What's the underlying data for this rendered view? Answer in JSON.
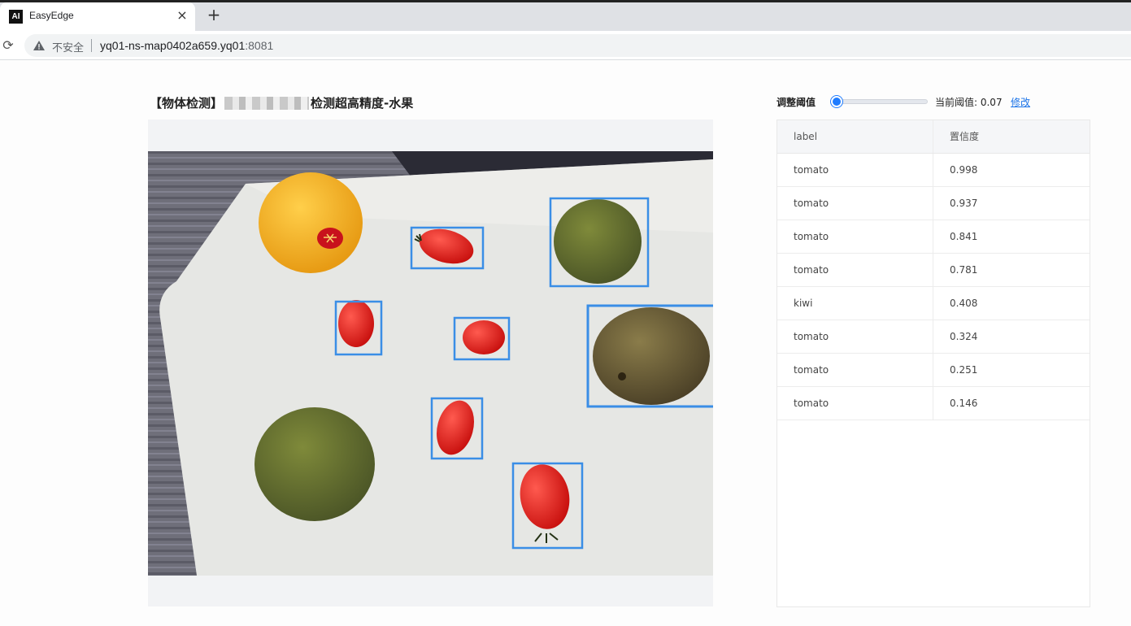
{
  "browser": {
    "tab_title": "EasyEdge",
    "favicon_text": "AI",
    "close_glyph": "×",
    "new_tab_glyph": "+",
    "reload_glyph": "⟳",
    "security_label": "不安全",
    "url_host": "yq01-ns-map0402a659.yq01",
    "url_port": ":8081"
  },
  "page": {
    "title_prefix": "【物体检测】",
    "title_suffix": "检测超高精度-水果"
  },
  "threshold": {
    "label": "调整阈值",
    "value": 0.07,
    "current_text": "当前阈值: 0.07",
    "modify_label": "修改"
  },
  "table": {
    "headers": [
      "label",
      "置信度"
    ],
    "rows": [
      {
        "label": "tomato",
        "score": "0.998"
      },
      {
        "label": "tomato",
        "score": "0.937"
      },
      {
        "label": "tomato",
        "score": "0.841"
      },
      {
        "label": "tomato",
        "score": "0.781"
      },
      {
        "label": "kiwi",
        "score": "0.408"
      },
      {
        "label": "tomato",
        "score": "0.324"
      },
      {
        "label": "tomato",
        "score": "0.251"
      },
      {
        "label": "tomato",
        "score": "0.146"
      }
    ]
  },
  "colors": {
    "accent": "#1f7cff",
    "box": "#3a8ee6",
    "link": "#1a73e8"
  }
}
